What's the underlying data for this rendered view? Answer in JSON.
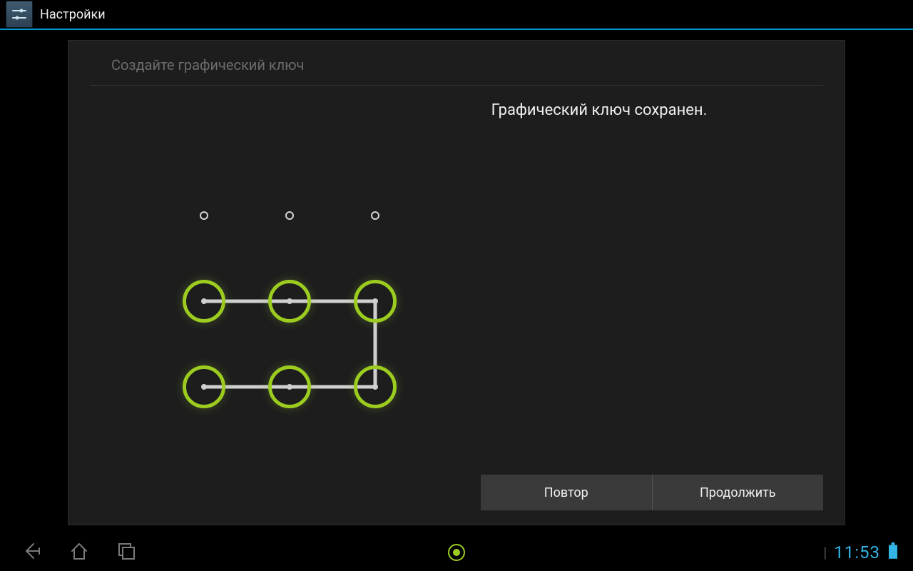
{
  "header": {
    "title": "Настройки"
  },
  "panel": {
    "title": "Создайте графический ключ",
    "status": "Графический ключ сохранен."
  },
  "pattern": {
    "grid": 3,
    "selected": [
      3,
      4,
      5,
      6,
      7,
      8
    ],
    "path": [
      3,
      4,
      5,
      8,
      7,
      6
    ]
  },
  "buttons": {
    "retry": "Повтор",
    "continue": "Продолжить"
  },
  "statusbar": {
    "time": "11:53"
  }
}
